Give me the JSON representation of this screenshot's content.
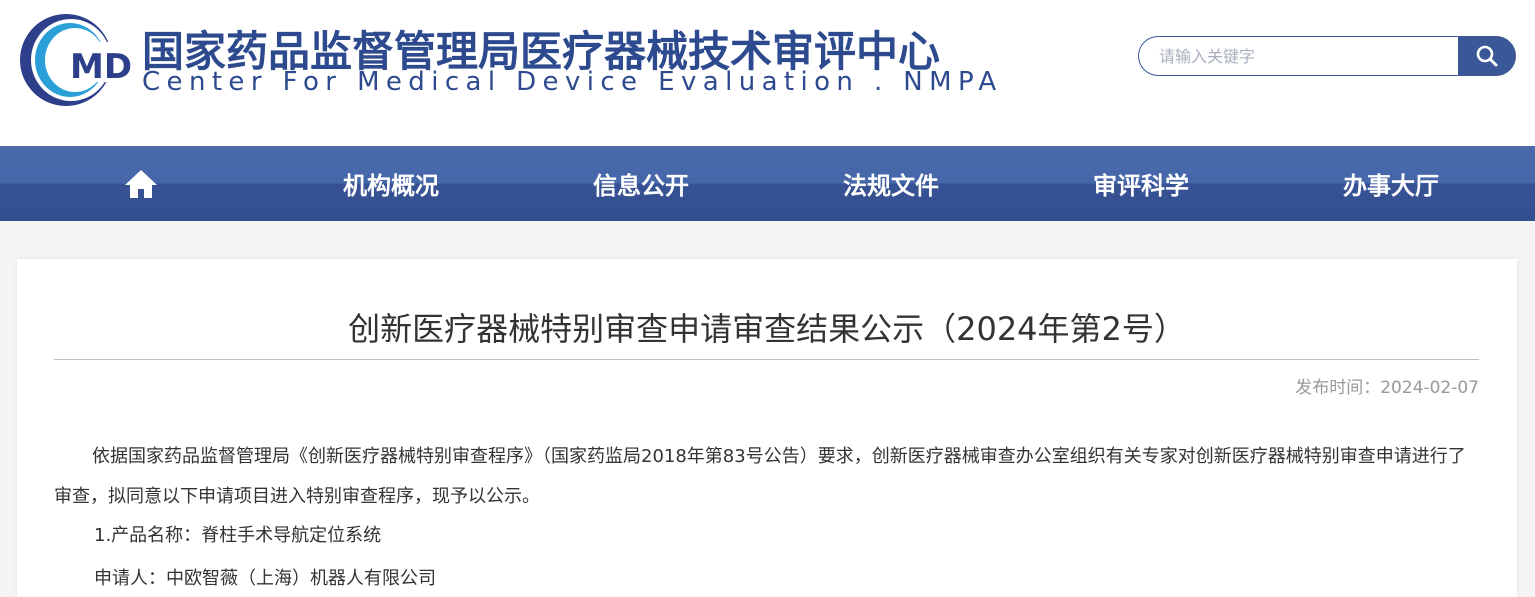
{
  "header": {
    "logo_text": "MDE",
    "title_cn": "国家药品监督管理局医疗器械技术审评中心",
    "title_en": "Center For Medical Device Evaluation . NMPA"
  },
  "search": {
    "placeholder": "请输入关键字",
    "button_icon": "search-icon"
  },
  "nav": {
    "home_icon": "home-icon",
    "items": [
      {
        "label": "机构概况"
      },
      {
        "label": "信息公开"
      },
      {
        "label": "法规文件"
      },
      {
        "label": "审评科学"
      },
      {
        "label": "办事大厅"
      }
    ]
  },
  "article": {
    "title": "创新医疗器械特别审查申请审查结果公示（2024年第2号）",
    "publish_label": "发布时间：",
    "publish_date": "2024-02-07",
    "intro": "依据国家药品监督管理局《创新医疗器械特别审查程序》（国家药监局2018年第83号公告）要求，创新医疗器械审查办公室组织有关专家对创新医疗器械特别审查申请进行了审查，拟同意以下申请项目进入特别审查程序，现予以公示。",
    "item_1_product": "1.产品名称：脊柱手术导航定位系统",
    "item_1_applicant": "申请人：中欧智薇（上海）机器人有限公司"
  },
  "colors": {
    "brand_blue": "#2d4a8f",
    "nav_top": "#4a6aac",
    "nav_bottom": "#35508f",
    "search_button": "#3a5898"
  }
}
